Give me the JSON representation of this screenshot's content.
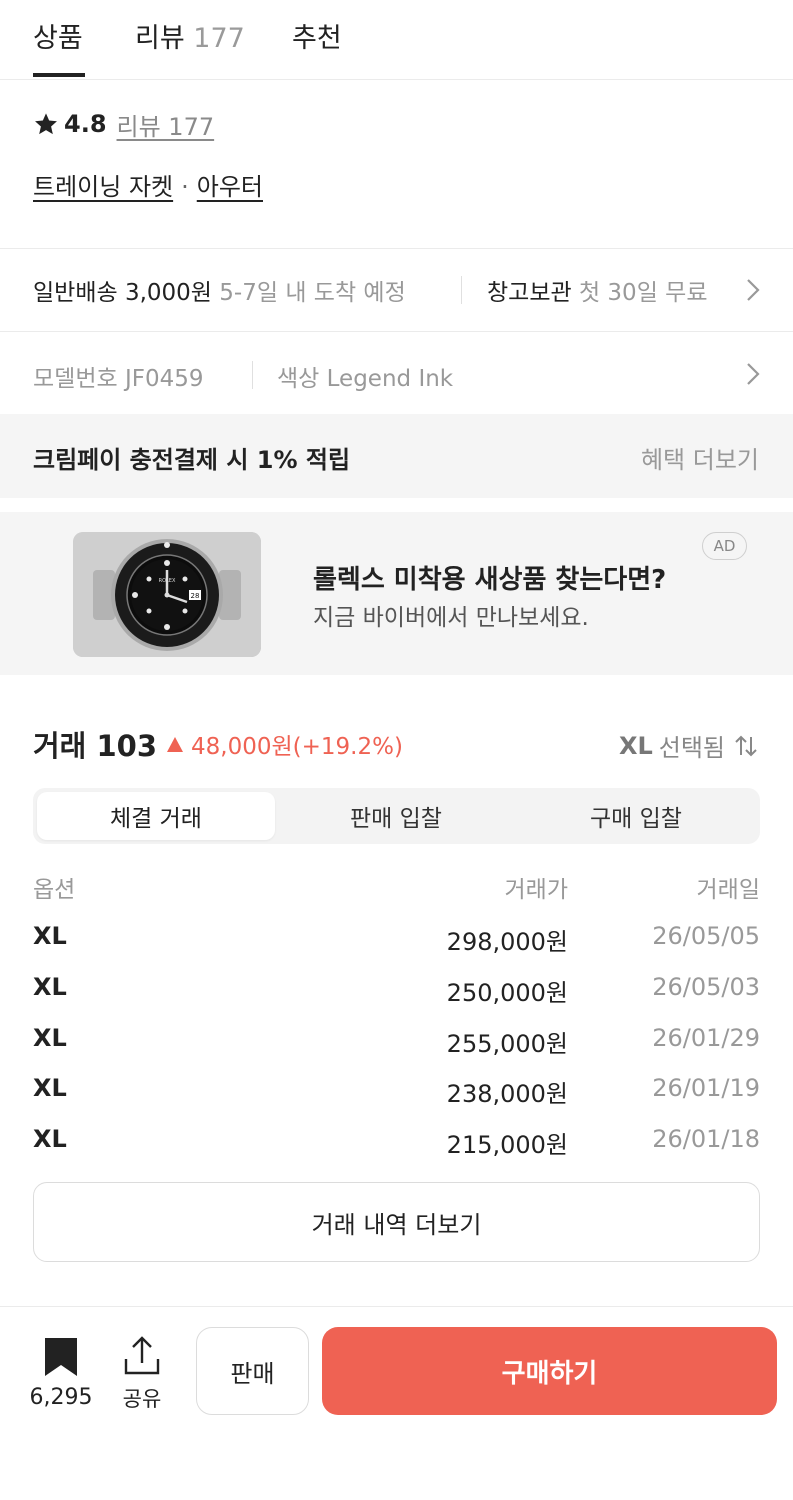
{
  "tabs": [
    {
      "label": "상품",
      "count": ""
    },
    {
      "label": "리뷰",
      "count": "177"
    },
    {
      "label": "추천",
      "count": ""
    }
  ],
  "rating": {
    "score": "4.8",
    "review_link": "리뷰 177"
  },
  "categories": {
    "primary": "트레이닝 자켓",
    "separator": "·",
    "secondary": "아우터"
  },
  "delivery": {
    "label": "일반배송",
    "fee": "3,000원",
    "eta": "5-7일 내 도착 예정",
    "storage_label": "창고보관",
    "storage_note": "첫 30일 무료"
  },
  "model": {
    "label": "모델번호",
    "value": "JF0459",
    "color_label": "색상",
    "color_value": "Legend Ink"
  },
  "benefit": {
    "text": "크림페이 충전결제 시 1% 적립",
    "more": "혜택 더보기"
  },
  "ad": {
    "badge": "AD",
    "title": "롤렉스 미착용 새상품 찾는다면?",
    "subtitle": "지금 바이버에서 만나보세요.",
    "watch_brand": "ROLEX"
  },
  "trades": {
    "title": "거래 103",
    "change": "48,000원(+19.2%)",
    "selected_size": "XL",
    "selected_label": "선택됨",
    "segments": [
      "체결 거래",
      "판매 입찰",
      "구매 입찰"
    ],
    "columns": [
      "옵션",
      "거래가",
      "거래일"
    ],
    "rows": [
      {
        "option": "XL",
        "price": "298,000원",
        "date": "26/05/05"
      },
      {
        "option": "XL",
        "price": "250,000원",
        "date": "26/05/03"
      },
      {
        "option": "XL",
        "price": "255,000원",
        "date": "26/01/29"
      },
      {
        "option": "XL",
        "price": "238,000원",
        "date": "26/01/19"
      },
      {
        "option": "XL",
        "price": "215,000원",
        "date": "26/01/18"
      }
    ],
    "more_button": "거래 내역 더보기"
  },
  "bottom_bar": {
    "bookmark_count": "6,295",
    "share_label": "공유",
    "sell_label": "판매",
    "buy_label": "구매하기"
  },
  "colors": {
    "accent": "#ef6253",
    "muted": "#999999",
    "text": "#222222",
    "panel": "#f5f5f5"
  }
}
